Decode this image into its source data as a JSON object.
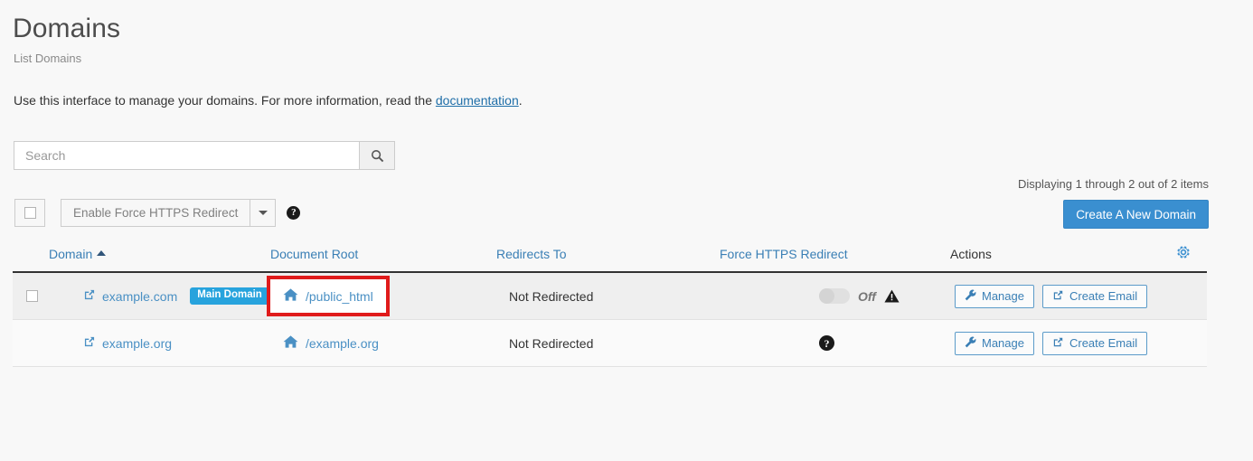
{
  "header": {
    "title": "Domains",
    "breadcrumb": "List Domains",
    "intro_before": "Use this interface to manage your domains. For more information, read the ",
    "intro_link": "documentation",
    "intro_after": "."
  },
  "search": {
    "placeholder": "Search",
    "value": "",
    "icon": "search-icon"
  },
  "toolbar": {
    "bulk_action_label": "Enable Force HTTPS Redirect",
    "caret_icon": "chevron-down-icon",
    "help_icon": "question-mark-icon",
    "help_glyph": "?",
    "create_label": "Create A New Domain",
    "displaying": "Displaying 1 through 2 out of 2 items"
  },
  "table": {
    "columns": [
      {
        "label": "Domain",
        "sortable": true,
        "sorted": "asc"
      },
      {
        "label": "Document Root",
        "sortable": true
      },
      {
        "label": "Redirects To",
        "sortable": true
      },
      {
        "label": "Force HTTPS Redirect",
        "sortable": true
      },
      {
        "label": "Actions",
        "sortable": false
      }
    ],
    "settings_icon": "gear-icon",
    "rows": [
      {
        "has_checkbox": true,
        "checked": false,
        "domain": "example.com",
        "domain_icon": "external-link-icon",
        "badge": "Main Domain",
        "document_root": "/public_html",
        "docroot_icon": "home-icon",
        "highlighted": true,
        "redirects_to": "Not Redirected",
        "https_control": "toggle",
        "https_toggle_state": "Off",
        "https_warning_icon": "warning-triangle-icon",
        "actions": [
          {
            "label": "Manage",
            "icon": "wrench-icon"
          },
          {
            "label": "Create Email",
            "icon": "external-link-icon"
          }
        ]
      },
      {
        "has_checkbox": false,
        "domain": "example.org",
        "domain_icon": "external-link-icon",
        "badge": "",
        "document_root": "/example.org",
        "docroot_icon": "home-icon",
        "highlighted": false,
        "redirects_to": "Not Redirected",
        "https_control": "help",
        "https_help_icon": "question-mark-icon",
        "https_help_glyph": "?",
        "actions": [
          {
            "label": "Manage",
            "icon": "wrench-icon"
          },
          {
            "label": "Create Email",
            "icon": "external-link-icon"
          }
        ]
      }
    ]
  },
  "colors": {
    "accent_blue": "#3a8fd0",
    "badge_blue": "#27a3dd",
    "link_blue": "#4a90c4",
    "header_link_blue": "#3a7fb5",
    "highlight_red": "#e01b1b",
    "page_bg": "#f8f8f8"
  }
}
